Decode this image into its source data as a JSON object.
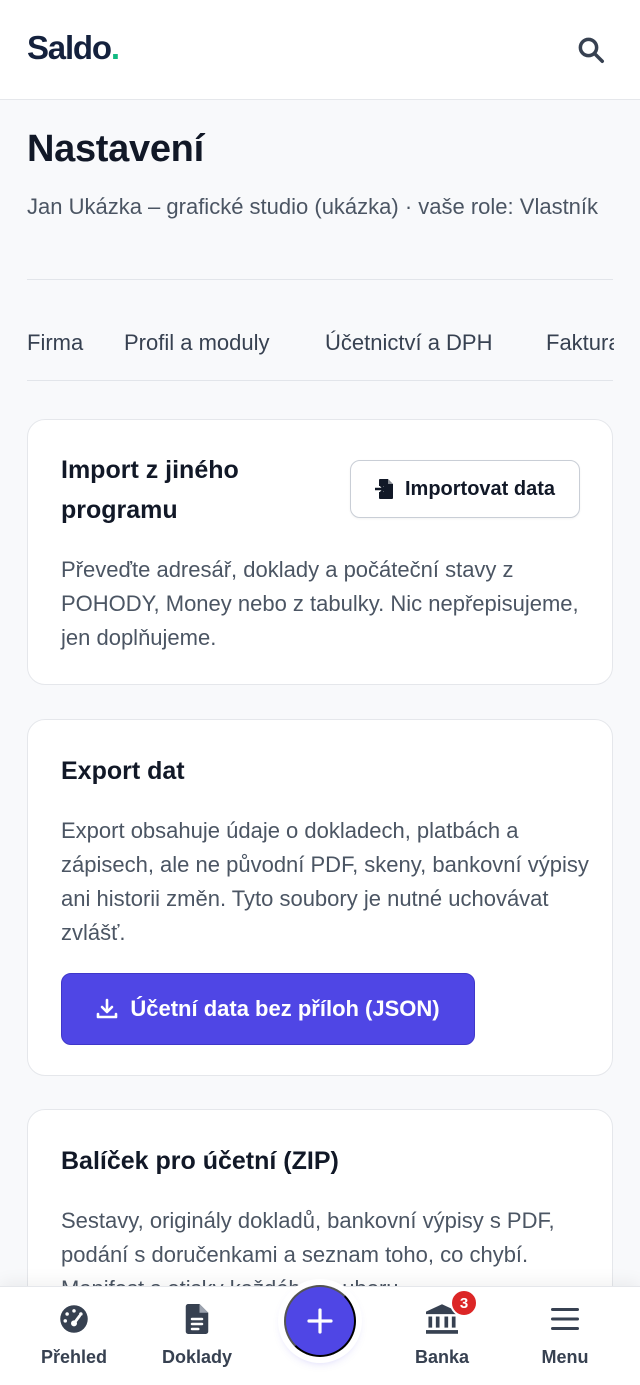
{
  "app": {
    "logo_text": "Saldo",
    "logo_dot": ".",
    "brand_color": "#14213d",
    "accent_color": "#4f46e5",
    "dot_color": "#10b981"
  },
  "page": {
    "title": "Nastavení",
    "subtitle": "Jan Ukázka – grafické studio (ukázka) · vaše role: Vlastník"
  },
  "tabs": [
    {
      "label": "Firma"
    },
    {
      "label": "Profil a moduly"
    },
    {
      "label": "Účetnictví a DPH"
    },
    {
      "label": "Fakturace"
    }
  ],
  "import_card": {
    "title": "Import z jiného programu",
    "button_label": "Importovat data",
    "button_icon": "file-import-icon",
    "text": "Převeďte adresář, doklady a počáteční stavy z POHODY, Money nebo z tabulky. Nic nepřepisujeme, jen doplňujeme."
  },
  "export_card": {
    "title": "Export dat",
    "text": "Export obsahuje údaje o dokladech, platbách a zápisech, ale ne původní PDF, skeny, bankovní výpisy ani historii změn. Tyto soubory je nutné uchovávat zvlášť.",
    "button_label": "Účetní data bez příloh (JSON)",
    "button_icon": "download-icon"
  },
  "zip_card": {
    "title": "Balíček pro účetní (ZIP)",
    "text": "Sestavy, originály dokladů, bankovní výpisy s PDF, podání s doručenkami a seznam toho, co chybí. Manifest s otisky každého souboru."
  },
  "bottom_nav": {
    "items": [
      {
        "label": "Přehled",
        "icon": "gauge-icon"
      },
      {
        "label": "Doklady",
        "icon": "document-icon"
      },
      {
        "label": "Banka",
        "icon": "bank-icon",
        "badge": "3"
      },
      {
        "label": "Menu",
        "icon": "hamburger-icon"
      }
    ],
    "fab_icon": "plus-icon"
  }
}
